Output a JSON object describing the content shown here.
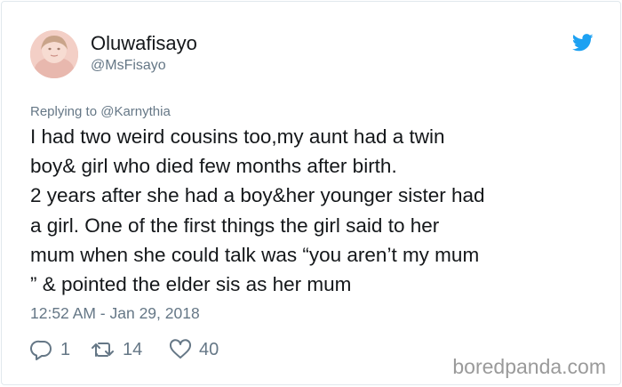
{
  "user": {
    "display_name": "Oluwafisayo",
    "handle": "@MsFisayo"
  },
  "reply_context": {
    "prefix": "Replying to",
    "replied_user": "@Karnythia"
  },
  "tweet": {
    "lines": [
      "I had two weird cousins too,my aunt had a twin",
      "boy& girl who died few months after birth.",
      "2 years after she had a boy&her younger sister had",
      "a girl. One of the first things the girl said to her",
      "mum when she could talk was “you aren’t my mum",
      "” & pointed the elder sis as her mum"
    ],
    "timestamp": "12:52 AM - Jan 29, 2018"
  },
  "actions": {
    "replies": "1",
    "retweets": "14",
    "likes": "40"
  },
  "watermark": "boredpanda.com",
  "icons": {
    "brand": "twitter-bird-icon",
    "reply": "reply-icon",
    "retweet": "retweet-icon",
    "like": "heart-icon"
  },
  "colors": {
    "twitter_blue": "#1da1f2",
    "secondary_text": "#657786",
    "primary_text": "#14171a",
    "watermark": "#9a9a9a"
  }
}
